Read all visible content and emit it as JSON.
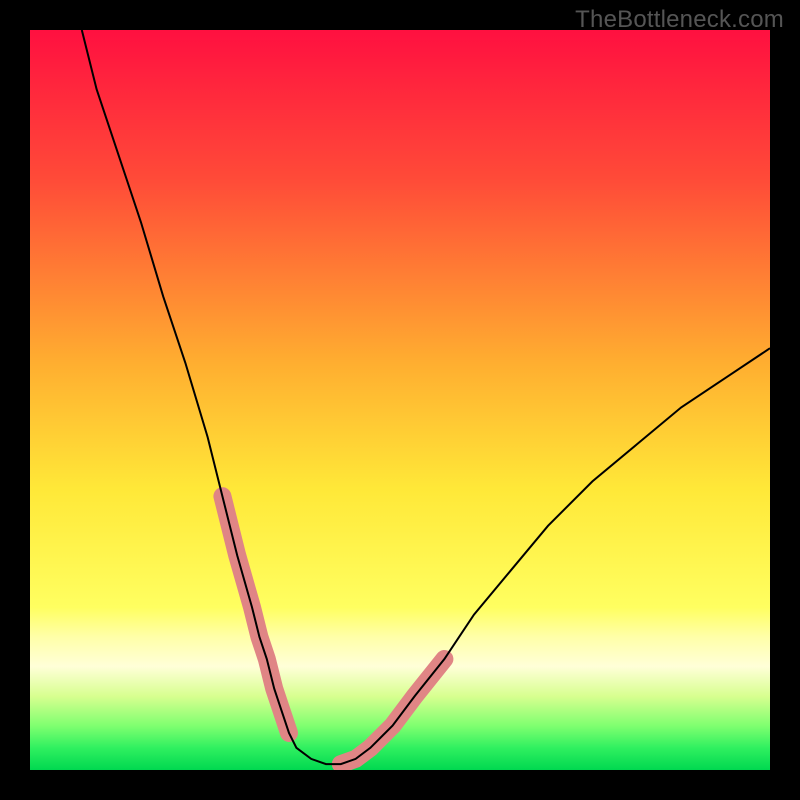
{
  "watermark": "TheBottleneck.com",
  "colors": {
    "frame_bg": "#000000",
    "curve": "#000000",
    "band_salmon": "#E08585",
    "gradient_stops": [
      {
        "offset": 0.0,
        "color": "#FF1040"
      },
      {
        "offset": 0.2,
        "color": "#FF4A38"
      },
      {
        "offset": 0.45,
        "color": "#FFAE30"
      },
      {
        "offset": 0.62,
        "color": "#FFE838"
      },
      {
        "offset": 0.78,
        "color": "#FFFF60"
      },
      {
        "offset": 0.82,
        "color": "#FFFFA8"
      },
      {
        "offset": 0.86,
        "color": "#FFFFD8"
      },
      {
        "offset": 0.9,
        "color": "#D8FF90"
      },
      {
        "offset": 0.94,
        "color": "#80FF70"
      },
      {
        "offset": 0.97,
        "color": "#30F060"
      },
      {
        "offset": 1.0,
        "color": "#00D850"
      }
    ]
  },
  "chart_data": {
    "type": "line",
    "title": "",
    "xlabel": "",
    "ylabel": "",
    "xlim": [
      0,
      100
    ],
    "ylim": [
      0,
      100
    ],
    "grid": false,
    "series": [
      {
        "name": "curve",
        "x": [
          7,
          9,
          12,
          15,
          18,
          21,
          24,
          26,
          28,
          30,
          31,
          32,
          33,
          34,
          35,
          36,
          38,
          40,
          42,
          44,
          46,
          49,
          52,
          56,
          60,
          65,
          70,
          76,
          82,
          88,
          94,
          100
        ],
        "y": [
          100,
          92,
          83,
          74,
          64,
          55,
          45,
          37,
          29,
          22,
          18,
          15,
          11,
          8,
          5,
          3,
          1.5,
          0.8,
          0.8,
          1.5,
          3,
          6,
          10,
          15,
          21,
          27,
          33,
          39,
          44,
          49,
          53,
          57
        ]
      }
    ],
    "highlight_bands": [
      {
        "name": "left-salmon-band",
        "x_range": [
          26,
          35
        ],
        "y_range": [
          5,
          37
        ]
      },
      {
        "name": "right-salmon-band",
        "x_range": [
          42,
          56
        ],
        "y_range": [
          1,
          16
        ]
      }
    ],
    "minimum": {
      "x": 41,
      "y": 0.8
    }
  }
}
